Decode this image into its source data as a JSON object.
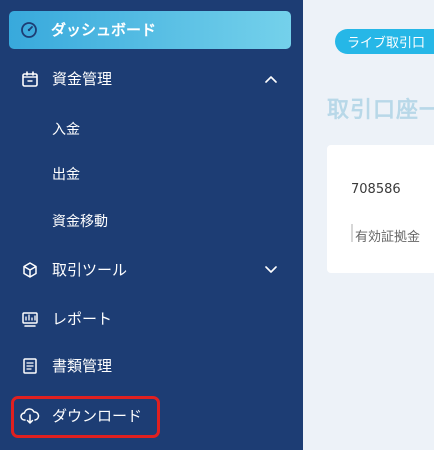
{
  "sidebar": {
    "active_item": {
      "label": "ダッシュボード",
      "icon": "gauge-icon"
    },
    "items": [
      {
        "label": "資金管理",
        "icon": "calendar-icon",
        "expanded": true,
        "children": [
          {
            "label": "入金"
          },
          {
            "label": "出金"
          },
          {
            "label": "資金移動"
          }
        ]
      },
      {
        "label": "取引ツール",
        "icon": "cube-icon",
        "expanded": false
      },
      {
        "label": "レポート",
        "icon": "report-icon"
      },
      {
        "label": "書類管理",
        "icon": "document-icon"
      },
      {
        "label": "ダウンロード",
        "icon": "download-cloud-icon"
      }
    ]
  },
  "content": {
    "pill_label": "ライブ取引口",
    "title": "取引口座一",
    "account_number": "708586",
    "margin_label": "有効証拠金"
  },
  "colors": {
    "sidebar_bg": "#1d3d74",
    "active_gradient_start": "#38a9dc",
    "active_gradient_end": "#74d1eb",
    "highlight": "#e02020",
    "pill": "#26b7e7"
  }
}
